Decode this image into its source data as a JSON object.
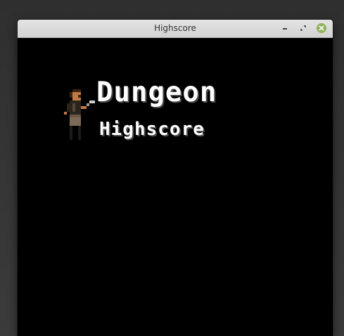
{
  "window": {
    "title": "Highscore",
    "controls": {
      "minimize_icon": "minimize-icon",
      "maximize_icon": "restore-icon",
      "close_icon": "close-icon",
      "close_color": "#8fb25a"
    }
  },
  "game": {
    "title": "Dungeon",
    "subtitle": "Highscore",
    "hero_icon": "adventurer-sprite-icon",
    "background": "#000000",
    "text_color": "#ffffff"
  }
}
